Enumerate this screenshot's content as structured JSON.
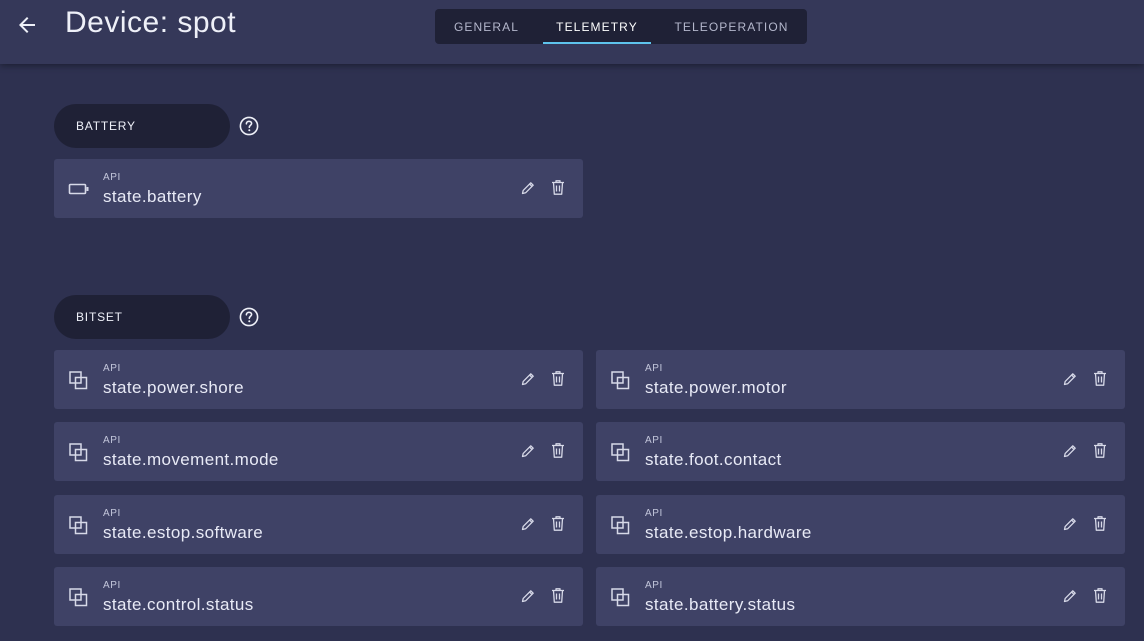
{
  "header": {
    "title": "Device: spot",
    "back_icon": "arrow-left-icon",
    "tabs": [
      {
        "label": "GENERAL",
        "active": false
      },
      {
        "label": "TELEMETRY",
        "active": true
      },
      {
        "label": "TELEOPERATION",
        "active": false
      }
    ]
  },
  "sections": {
    "battery": {
      "label": "BATTERY",
      "help_icon": "help-circle-icon",
      "items": [
        {
          "caption": "API",
          "value": "state.battery",
          "icon": "battery-icon"
        }
      ]
    },
    "bitset": {
      "label": "BITSET",
      "help_icon": "help-circle-icon",
      "items": [
        {
          "caption": "API",
          "value": "state.power.shore",
          "icon": "bitset-icon"
        },
        {
          "caption": "API",
          "value": "state.power.motor",
          "icon": "bitset-icon"
        },
        {
          "caption": "API",
          "value": "state.movement.mode",
          "icon": "bitset-icon"
        },
        {
          "caption": "API",
          "value": "state.foot.contact",
          "icon": "bitset-icon"
        },
        {
          "caption": "API",
          "value": "state.estop.software",
          "icon": "bitset-icon"
        },
        {
          "caption": "API",
          "value": "state.estop.hardware",
          "icon": "bitset-icon"
        },
        {
          "caption": "API",
          "value": "state.control.status",
          "icon": "bitset-icon"
        },
        {
          "caption": "API",
          "value": "state.battery.status",
          "icon": "bitset-icon"
        }
      ]
    }
  },
  "colors": {
    "background": "#2e3150",
    "header": "#353859",
    "card": "#3f4266",
    "pill": "#1f2136",
    "accent": "#5ec3ec"
  }
}
